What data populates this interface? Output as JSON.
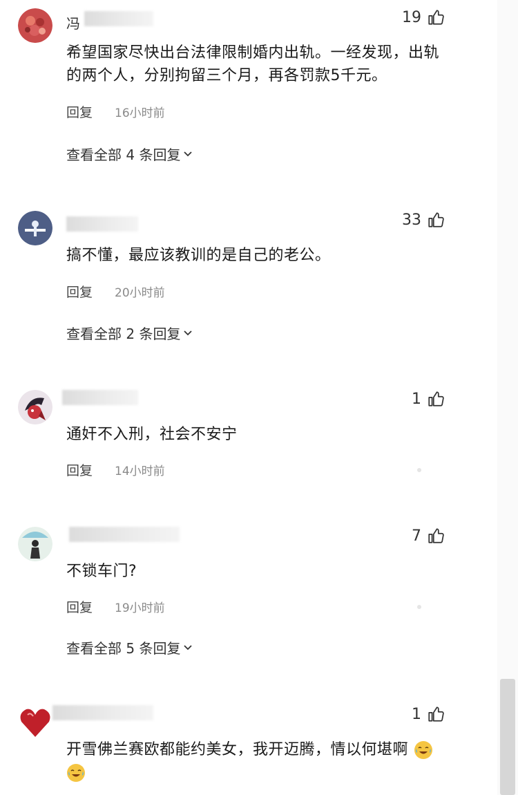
{
  "comments": [
    {
      "username_visible": "冯",
      "avatar_icon": "red-flower-avatar-icon",
      "likes": "19",
      "text": "希望国家尽快出台法律限制婚内出轨。一经发现，出轨的两个人，分别拘留三个月，再各罚款5千元。",
      "reply_label": "回复",
      "time": "16小时前",
      "view_replies": "查看全部 4 条回复"
    },
    {
      "username_visible": "",
      "avatar_icon": "blue-figure-avatar-icon",
      "likes": "33",
      "text": "搞不懂，最应该教训的是自己的老公。",
      "reply_label": "回复",
      "time": "20小时前",
      "view_replies": "查看全部 2 条回复"
    },
    {
      "username_visible": "",
      "avatar_icon": "anime-girl-avatar-icon",
      "likes": "1",
      "text": "通奸不入刑，社会不安宁",
      "reply_label": "回复",
      "time": "14小时前",
      "view_replies": ""
    },
    {
      "username_visible": "",
      "avatar_icon": "girl-umbrella-avatar-icon",
      "likes": "7",
      "text": "不锁车门?",
      "reply_label": "回复",
      "time": "19小时前",
      "view_replies": "查看全部 5 条回复"
    },
    {
      "username_visible": "",
      "avatar_icon": "red-heart-avatar-icon",
      "likes": "1",
      "text": "开雪佛兰赛欧都能约美女，我开迈腾，情以何堪啊",
      "reply_label": "",
      "time": "",
      "view_replies": ""
    }
  ],
  "colors": {
    "text": "#1a1a1a",
    "meta": "#8a8a8a",
    "emoji": "#f5c542"
  },
  "icons": {
    "like": "thumbs-up-icon",
    "chevron": "chevron-down-icon",
    "emoji": "crying-laughing-emoji-icon"
  }
}
